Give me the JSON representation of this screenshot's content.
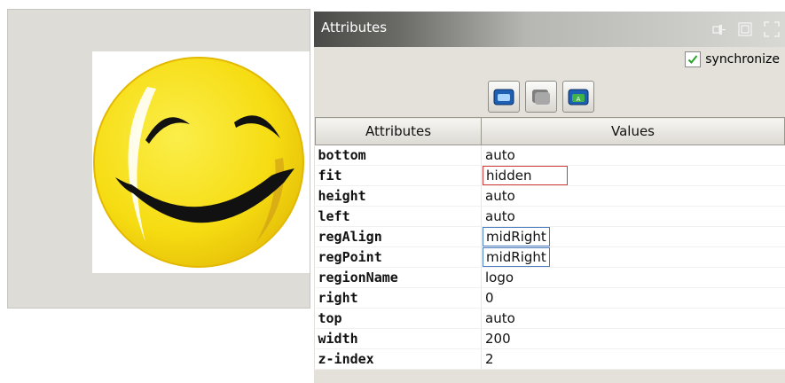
{
  "panel": {
    "title": "Attributes",
    "synchronize_label": "synchronize",
    "synchronize_checked": true,
    "header_icons": [
      "pin-icon",
      "restore-icon",
      "maximize-icon"
    ],
    "toolbar_icons": [
      "open-folder-icon",
      "copy-icon",
      "save-icon"
    ]
  },
  "table": {
    "headers": [
      "Attributes",
      "Values"
    ],
    "rows": [
      {
        "name": "bottom",
        "value": "auto",
        "highlight": ""
      },
      {
        "name": "fit",
        "value": "hidden",
        "highlight": "red"
      },
      {
        "name": "height",
        "value": "auto",
        "highlight": ""
      },
      {
        "name": "left",
        "value": "auto",
        "highlight": ""
      },
      {
        "name": "regAlign",
        "value": "midRight",
        "highlight": "blue"
      },
      {
        "name": "regPoint",
        "value": "midRight",
        "highlight": "blue"
      },
      {
        "name": "regionName",
        "value": "logo",
        "highlight": ""
      },
      {
        "name": "right",
        "value": "0",
        "highlight": ""
      },
      {
        "name": "top",
        "value": "auto",
        "highlight": ""
      },
      {
        "name": "width",
        "value": "200",
        "highlight": ""
      },
      {
        "name": "z-index",
        "value": "2",
        "highlight": ""
      }
    ]
  },
  "preview": {
    "image": "smiley-face-logo"
  },
  "colors": {
    "smiley_yellow": "#f7e21a",
    "highlight_red": "#d23a3a",
    "highlight_blue": "#4a7cc0"
  }
}
